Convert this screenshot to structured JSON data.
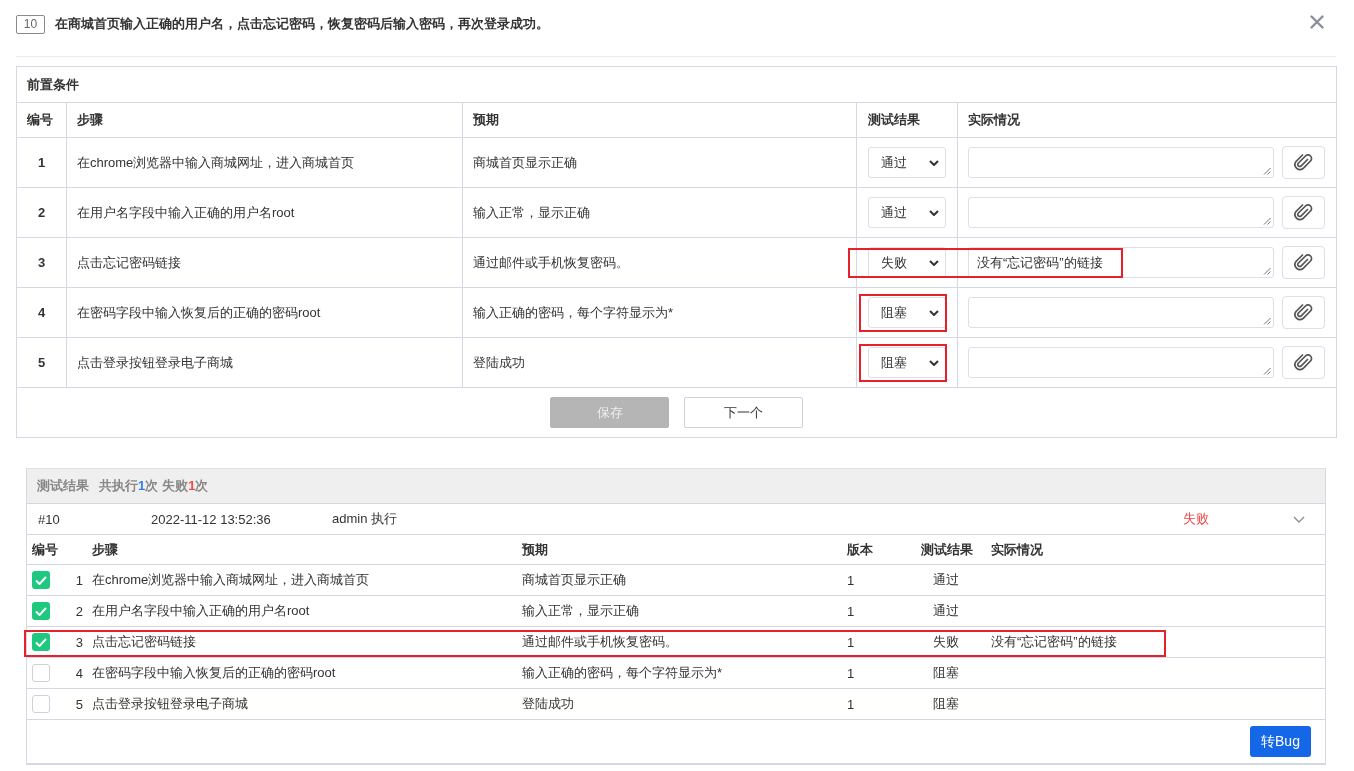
{
  "header": {
    "case_number": "10",
    "title": "在商城首页输入正确的用户名，点击忘记密码，恢复密码后输入密码，再次登录成功。"
  },
  "steps_table": {
    "title": "前置条件",
    "columns": [
      "编号",
      "步骤",
      "预期",
      "测试结果",
      "实际情况"
    ],
    "rows": [
      {
        "number": "1",
        "step": "在chrome浏览器中输入商城网址，进入商城首页",
        "expected": "商城首页显示正确",
        "result": "通过",
        "highlight_result": false,
        "highlight_actual": false
      },
      {
        "number": "2",
        "step": "在用户名字段中输入正确的用户名root",
        "expected": "输入正常，显示正确",
        "result": "通过",
        "highlight_result": false,
        "highlight_actual": false
      },
      {
        "number": "3",
        "step": "点击忘记密码链接",
        "expected": "通过邮件或手机恢复密码。",
        "result": "失败",
        "actual": "没有“忘记密码”的链接",
        "highlight_result": true,
        "highlight_actual": true
      },
      {
        "number": "4",
        "step": "在密码字段中输入恢复后的正确的密码root",
        "expected": "输入正确的密码，每个字符显示为*",
        "result": "阻塞",
        "highlight_result": true,
        "highlight_actual": false
      },
      {
        "number": "5",
        "step": "点击登录按钮登录电子商城",
        "expected": "登陆成功",
        "result": "阻塞",
        "highlight_result": true,
        "highlight_actual": false
      }
    ],
    "actions": [
      {
        "label": "保存",
        "disabled": true
      },
      {
        "label": "下一个",
        "disabled": false
      }
    ]
  },
  "results": {
    "title": "测试结果",
    "stats": [
      {
        "label": "共执行",
        "count": "1",
        "unit": "次",
        "color": "#2f80ed"
      },
      {
        "label": "失败",
        "count": "1",
        "unit": "次",
        "color": "#f04848"
      }
    ],
    "run": {
      "id": "#10",
      "time": "2022-11-12 13:52:36",
      "executor": "admin 执行",
      "status": "失败"
    },
    "columns": [
      "编号",
      "步骤",
      "预期",
      "版本",
      "测试结果",
      "实际情况"
    ],
    "rows": [
      {
        "checked": true,
        "number": "1",
        "step": "在chrome浏览器中输入商城网址，进入商城首页",
        "expected": "商城首页显示正确",
        "version": "1",
        "result": "通过",
        "highlighted": false
      },
      {
        "checked": true,
        "number": "2",
        "step": "在用户名字段中输入正确的用户名root",
        "expected": "输入正常，显示正确",
        "version": "1",
        "result": "通过",
        "highlighted": false
      },
      {
        "checked": true,
        "number": "3",
        "step": "点击忘记密码链接",
        "expected": "通过邮件或手机恢复密码。",
        "version": "1",
        "result": "失败",
        "actual": "没有“忘记密码”的链接",
        "highlighted": true
      },
      {
        "checked": false,
        "number": "4",
        "step": "在密码字段中输入恢复后的正确的密码root",
        "expected": "输入正确的密码，每个字符显示为*",
        "version": "1",
        "result": "阻塞",
        "highlighted": false
      },
      {
        "checked": false,
        "number": "5",
        "step": "点击登录按钮登录电子商城",
        "expected": "登陆成功",
        "version": "1",
        "result": "阻塞",
        "highlighted": false
      }
    ],
    "button": "转Bug"
  }
}
